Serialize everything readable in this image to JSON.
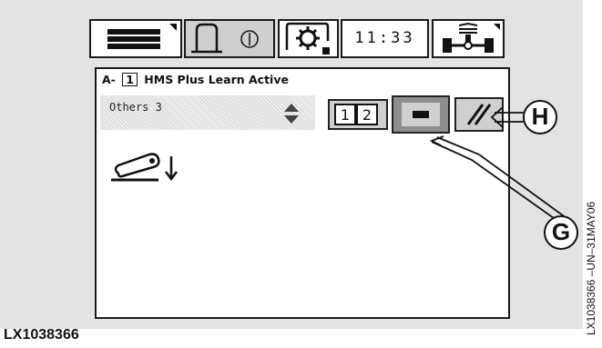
{
  "top_tabs": {
    "clock": "11:33"
  },
  "screen": {
    "prefix": "A-",
    "number": "1",
    "title": "HMS Plus Learn Active"
  },
  "selector": {
    "value": "Others 3"
  },
  "callouts": {
    "g": "G",
    "h": "H"
  },
  "figure": {
    "id": "LX1038366",
    "side_label": "LX1038366    –UN–31MAY06"
  },
  "colors": {
    "panel": "#e3e3e3",
    "button_selected": "#8e8e8e",
    "button_normal": "#d0d0d0"
  }
}
